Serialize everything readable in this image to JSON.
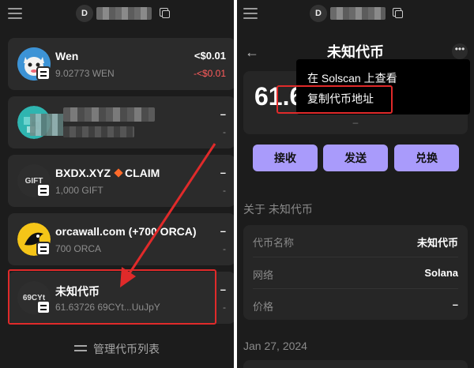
{
  "left": {
    "account_initial": "D",
    "tokens": [
      {
        "name": "Wen",
        "amount": "9.02773 WEN",
        "value": "<$0.01",
        "change": "-<$0.01"
      },
      {
        "name": "",
        "amount": "",
        "value": "–",
        "change": "-"
      },
      {
        "name": "BXDX.XYZ",
        "claim": "CLAIM",
        "icon_text": "GIFT",
        "amount": "1,000 GIFT",
        "value": "–",
        "change": "-"
      },
      {
        "name": "orcawall.com (+700 ORCA)",
        "amount": "700 ORCA",
        "value": "–",
        "change": "-"
      },
      {
        "name": "未知代币",
        "icon_text": "69CYt",
        "amount": "61.63726 69CYt...UuJpY",
        "value": "–",
        "change": "-"
      }
    ],
    "manage_label": "管理代币列表"
  },
  "right": {
    "account_initial": "D",
    "title": "未知代币",
    "more_label": "•••",
    "balance_prefix": "61.6",
    "balance_fiat": "–",
    "actions": {
      "receive": "接收",
      "send": "发送",
      "swap": "兑换"
    },
    "about_label": "关于 未知代币",
    "info": [
      {
        "key": "代币名称",
        "value": "未知代币"
      },
      {
        "key": "网络",
        "value": "Solana"
      },
      {
        "key": "价格",
        "value": "–"
      }
    ],
    "date": "Jan 27, 2024",
    "menu": {
      "view_solscan": "在 Solscan 上查看",
      "copy_address": "复制代币地址"
    }
  },
  "colors": {
    "accent": "#a99bfb",
    "annotation_red": "#e02a2a",
    "negative": "#ff5c5c"
  }
}
